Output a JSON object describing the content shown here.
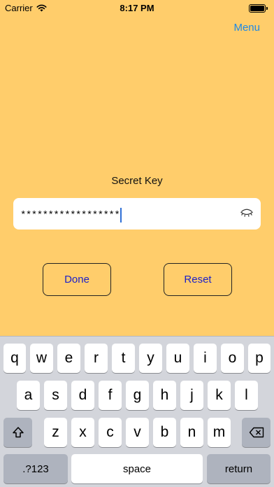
{
  "status": {
    "carrier": "Carrier",
    "time": "8:17 PM"
  },
  "nav": {
    "menu_label": "Menu"
  },
  "form": {
    "label": "Secret Key",
    "secret_value": "******************",
    "done_label": "Done",
    "reset_label": "Reset"
  },
  "keyboard": {
    "row1": [
      "q",
      "w",
      "e",
      "r",
      "t",
      "y",
      "u",
      "i",
      "o",
      "p"
    ],
    "row2": [
      "a",
      "s",
      "d",
      "f",
      "g",
      "h",
      "j",
      "k",
      "l"
    ],
    "row3": [
      "z",
      "x",
      "c",
      "v",
      "b",
      "n",
      "m"
    ],
    "numbers_label": ".?123",
    "space_label": "space",
    "return_label": "return"
  }
}
